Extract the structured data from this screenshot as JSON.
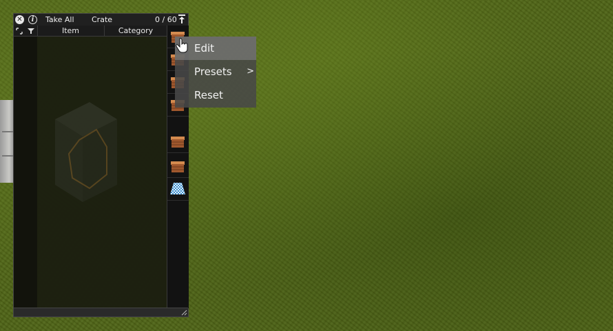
{
  "window": {
    "close_icon": "close-icon",
    "info_icon": "info-icon",
    "take_all_label": "Take All",
    "container_name": "Crate",
    "capacity": "0 / 60",
    "pin_icon": "pin-icon"
  },
  "table": {
    "columns": [
      "Item",
      "Category"
    ],
    "rows": []
  },
  "side_slots": [
    {
      "icon": "crate-icon"
    },
    {
      "icon": "crate-icon"
    },
    {
      "icon": "crate-icon"
    },
    {
      "icon": "crate-icon"
    },
    {
      "icon": "crate-icon"
    },
    {
      "icon": "crate-icon"
    },
    {
      "icon": "floor-tile-icon"
    }
  ],
  "context_menu": {
    "items": [
      {
        "label": "Edit",
        "has_submenu": false
      },
      {
        "label": "Presets",
        "has_submenu": true,
        "arrow": ">"
      },
      {
        "label": "Reset",
        "has_submenu": false
      }
    ]
  },
  "colors": {
    "grass": "#4f6416",
    "crate_wood": "#a0582e",
    "crate_highlight": "#d48b4f",
    "floor_tile": "#3c8fd0"
  }
}
